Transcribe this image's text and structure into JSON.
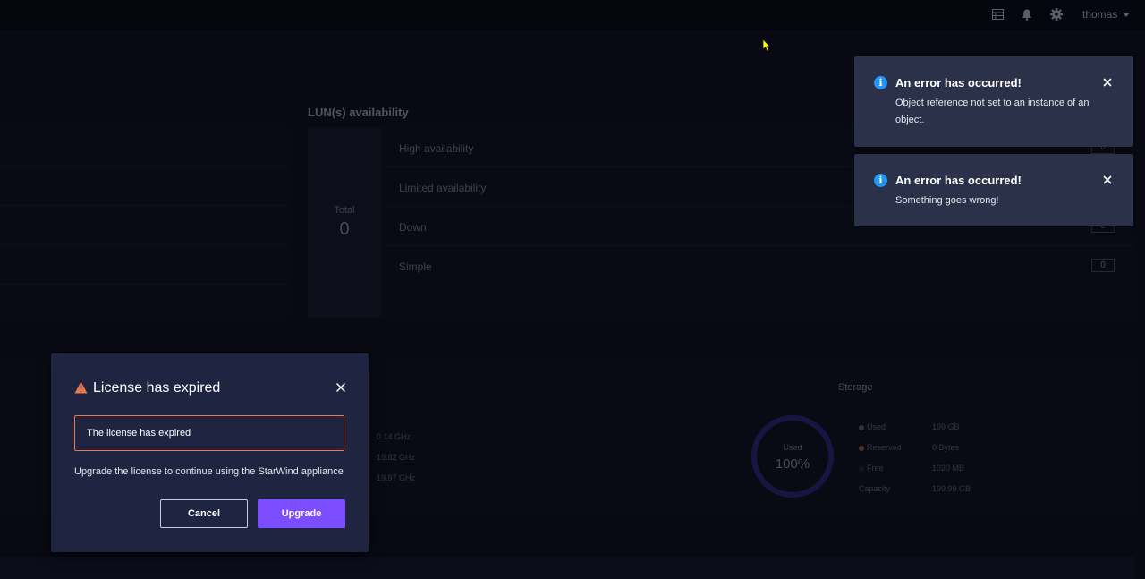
{
  "topbar": {
    "username": "thomas",
    "icons": [
      "list-icon",
      "bell-icon",
      "gear-icon"
    ]
  },
  "lun": {
    "title": "LUN(s) availability",
    "total_label": "Total",
    "total_value": "0",
    "rows": [
      {
        "label": "High availability",
        "count": "0"
      },
      {
        "label": "Limited availability",
        "count": "0"
      },
      {
        "label": "Down",
        "count": "0"
      },
      {
        "label": "Simple",
        "count": "0"
      }
    ]
  },
  "cpu": {
    "values": [
      "0.14 GHz",
      "19.82 GHz",
      "19.97 GHz"
    ]
  },
  "storage": {
    "title": "Storage",
    "donut_label": "Used",
    "donut_value": "100%",
    "used_fraction": 1.0,
    "legend": [
      {
        "label": "Used",
        "value": "199 GB",
        "color": "#4a4d66"
      },
      {
        "label": "Reserved",
        "value": "0 Bytes",
        "color": "#7a4a3a"
      },
      {
        "label": "Free",
        "value": "1020 MB",
        "color": "#1c1f33"
      },
      {
        "label": "Capacity",
        "value": "199.99 GB",
        "color": ""
      }
    ]
  },
  "toasts": [
    {
      "title": "An error has occurred!",
      "message": "Object reference not set to an instance of an object."
    },
    {
      "title": "An error has occurred!",
      "message": "Something goes wrong!"
    }
  ],
  "modal": {
    "title": "License has expired",
    "alert_text": "The license has expired",
    "description": "Upgrade the license to continue using the StarWind appliance",
    "cancel_label": "Cancel",
    "upgrade_label": "Upgrade",
    "accent_color": "#7c4dff",
    "warning_color": "#f0774a"
  }
}
